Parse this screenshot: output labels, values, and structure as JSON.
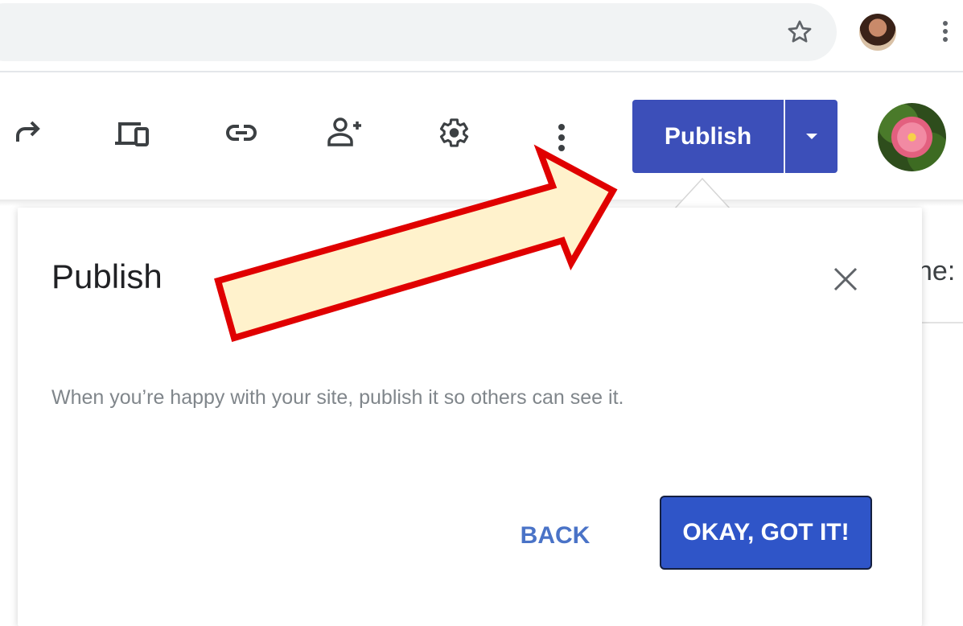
{
  "browser": {
    "bookmark_icon": "star-icon",
    "menu_icon": "more-vert-icon"
  },
  "toolbar": {
    "icons": [
      "redo-icon",
      "device-preview-icon",
      "link-icon",
      "share-person-add-icon",
      "settings-gear-icon",
      "more-vert-icon"
    ],
    "publish_label": "Publish",
    "publish_dropdown_icon": "caret-down-icon",
    "accent_color": "#3c4fb9"
  },
  "background": {
    "peek_text": "he:"
  },
  "popup": {
    "title": "Publish",
    "close_icon": "close-icon",
    "description": "When you’re happy with your site, publish it so others can see it.",
    "back_label": "BACK",
    "ok_label": "OKAY, GOT IT!"
  },
  "annotation": {
    "arrow_fill": "#fff2cc",
    "arrow_stroke": "#e00000"
  }
}
